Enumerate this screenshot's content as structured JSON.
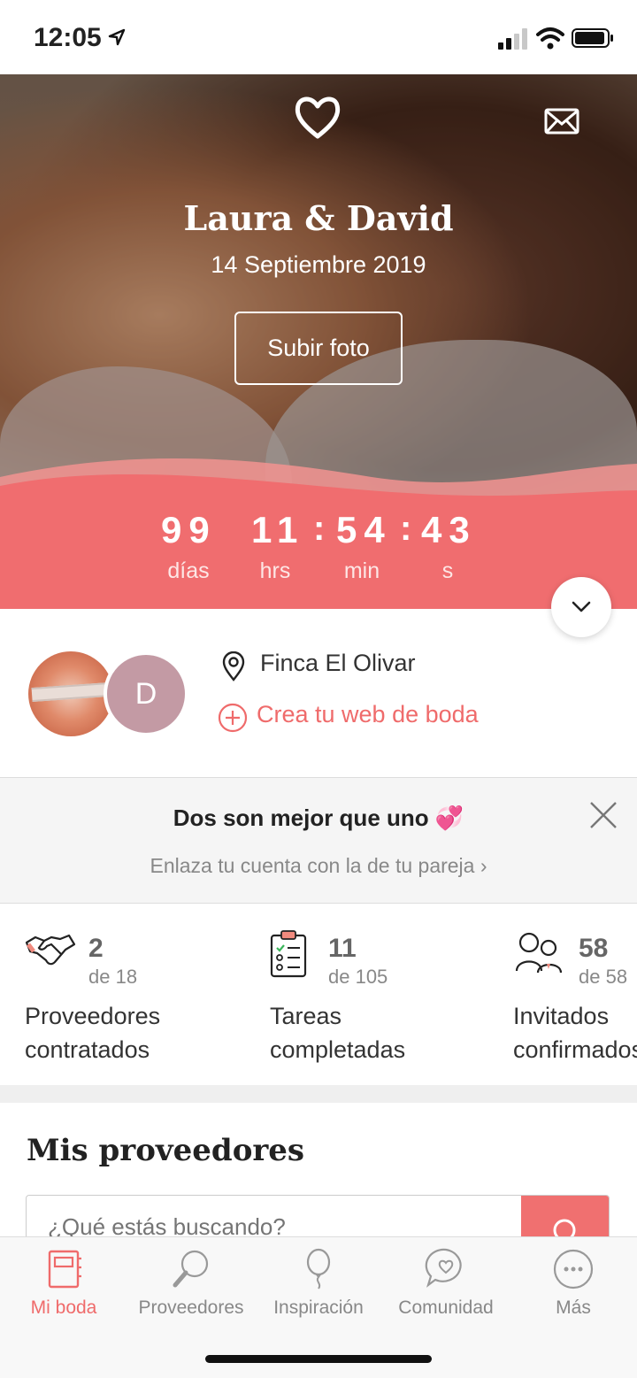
{
  "status_bar": {
    "time": "12:05"
  },
  "hero": {
    "names": "Laura & David",
    "date": "14 Septiembre 2019",
    "upload_button": "Subir foto"
  },
  "countdown": {
    "days": "99",
    "days_label": "días",
    "hours": "11",
    "hours_label": "hrs",
    "minutes": "54",
    "minutes_label": "min",
    "seconds": "43",
    "seconds_label": "s"
  },
  "couple": {
    "partner_initial": "D",
    "venue": "Finca El Olivar",
    "web_link": "Crea tu web de boda"
  },
  "partner_banner": {
    "title": "Dos son mejor que uno 💞",
    "subtitle": "Enlaza tu cuenta con la de tu pareja  ›"
  },
  "stats": [
    {
      "icon": "handshake-icon",
      "value": "2",
      "total": "de 18",
      "label1": "Proveedores",
      "label2": "contratados"
    },
    {
      "icon": "clipboard-icon",
      "value": "11",
      "total": "de 105",
      "label1": "Tareas",
      "label2": "completadas"
    },
    {
      "icon": "guests-icon",
      "value": "58",
      "total": "de 58",
      "label1": "Invitados",
      "label2": "confirmados"
    }
  ],
  "providers": {
    "title": "Mis proveedores",
    "search_placeholder": "¿Qué estás buscando?"
  },
  "tabs": [
    {
      "label": "Mi boda",
      "icon": "notebook-icon",
      "active": true
    },
    {
      "label": "Proveedores",
      "icon": "magnifier-icon",
      "active": false
    },
    {
      "label": "Inspiración",
      "icon": "balloon-icon",
      "active": false
    },
    {
      "label": "Comunidad",
      "icon": "chat-heart-icon",
      "active": false
    },
    {
      "label": "Más",
      "icon": "more-icon",
      "active": false
    }
  ],
  "colors": {
    "accent": "#F06D6F",
    "countdown_bg": "#F06D6F",
    "link": "#EF6B6B"
  }
}
